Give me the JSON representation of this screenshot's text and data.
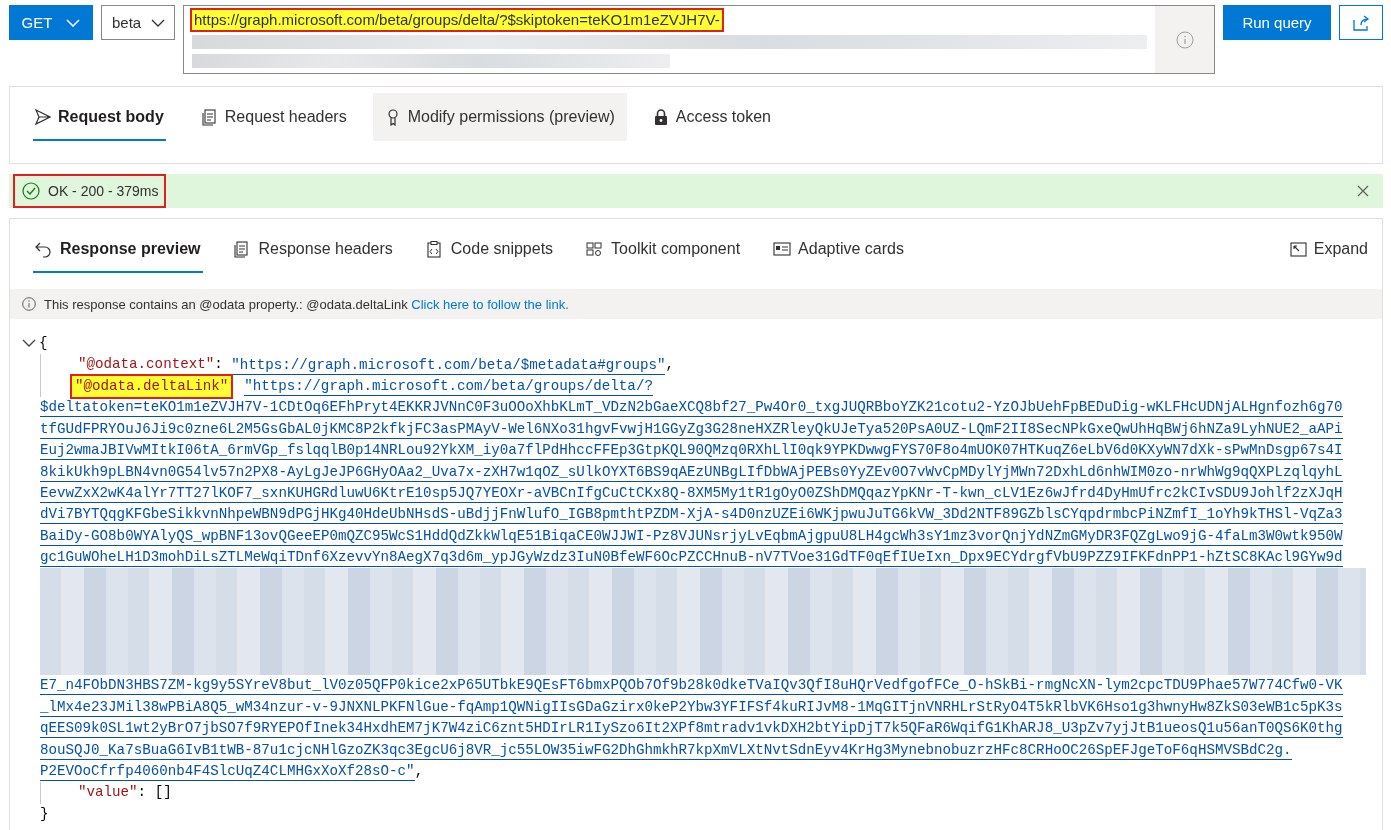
{
  "query_bar": {
    "method": "GET",
    "version": "beta",
    "url": "https://graph.microsoft.com/beta/groups/delta/?$skiptoken=teKO1m1eZVJH7V-",
    "url_highlighted": true,
    "run_button": "Run query"
  },
  "request_tabs": [
    {
      "label": "Request body",
      "selected": true,
      "hovered": false
    },
    {
      "label": "Request headers",
      "selected": false,
      "hovered": false
    },
    {
      "label": "Modify permissions (preview)",
      "selected": false,
      "hovered": true
    },
    {
      "label": "Access token",
      "selected": false,
      "hovered": false
    }
  ],
  "status": {
    "text": "OK - 200 - 379ms",
    "highlighted": true
  },
  "response_tabs": [
    {
      "label": "Response preview",
      "selected": true
    },
    {
      "label": "Response headers",
      "selected": false
    },
    {
      "label": "Code snippets",
      "selected": false
    },
    {
      "label": "Toolkit component",
      "selected": false
    },
    {
      "label": "Adaptive cards",
      "selected": false
    }
  ],
  "expand_button": "Expand",
  "notice": {
    "text": "This response contains an @odata property.: @odata.deltaLink ",
    "link": "Click here to follow the link."
  },
  "response_json": {
    "expanded": true,
    "open_brace": "{",
    "close_brace": "}",
    "properties": [
      {
        "key": "\"@odata.context\"",
        "separator": ":",
        "highlighted": false,
        "kind": "link",
        "first_line": "\"https://graph.microsoft.com/beta/$metadata#groups\"",
        "trailing": ","
      },
      {
        "key": "\"@odata.deltaLink\"",
        "highlighted": true,
        "kind": "link",
        "first_line": "\"https://graph.microsoft.com/beta/groups/delta/?",
        "lines": [
          {
            "kind": "text",
            "text": "$deltatoken=teKO1m1eZVJH7V-1CDtOq6EFhPryt4EKKRJVNnC0F3uOOoXhbKLmT_VDzN2bGaeXCQ8bf27_Pw4Or0_txgJUQRBboYZK21cotu2-YzOJbUehFpBEDuDig-wKLFHcUDNjALHgnfozh6g70"
          },
          {
            "kind": "text",
            "text": "tfGUdFPRYOuJ6Ji9c0zne6L2M5GsGbAL0jKMC8P2kfkjFC3asPMAyV-Wel6NXo31hgvFvwjH1GGyZg3G28neHXZRleyQkUJeTya520PsA0UZ-LQmF2II8SecNPkGxeQwUhHqBWj6hNZa9LyhNUE2_aAPi"
          },
          {
            "kind": "text",
            "text": "Euj2wmaJBIVwMItkI06tA_6rmVGp_fslqqlB0p14NRLou92YkXM_iy0a7flPdHhccFFEp3GtpKQL90QMzq0RXhLlI0qk9YPKDwwgFYS70F8o4mUOK07HTKuqZ6eLbV6d0KXyWN7dXk-sPwMnDsgp67s4I"
          },
          {
            "kind": "text",
            "text": "8kikUkh9pLBN4vn0G54lv57n2PX8-AyLgJeJP6GHyOAa2_Uva7x-zXH7w1qOZ_sUlkOYXT6BS9qAEzUNBgLIfDbWAjPEBs0YyZEv0O7vWvCpMDylYjMWn72DxhLd6nhWIM0zo-nrWhWg9qQXPLzqlqyhL"
          },
          {
            "kind": "text",
            "text": "EevwZxX2wK4alYr7TT27lKOF7_sxnKUHGRdluwU6KtrE10sp5JQ7YEOXr-aVBCnIfgCuCtCKx8Q-8XM5My1tR1gOyO0ZShDMQqazYpKNr-T-kwn_cLV1Ez6wJfrd4DyHmUfrc2kCIvSDU9Johlf2zXJqH"
          },
          {
            "kind": "text",
            "text": "dVi7BYTQqgKFGbeSikkvnNhpeWBN9dPGjHKg40HdeUbNHsdS-uBdjjFnWlufO_IGB8pmthtPZDM-XjA-s4D0nzUZEi6WKjpwuJuTG6kVW_3Dd2NTF89GZblsCYqpdrmbcPiNZmfI_1oYh9kTHSl-VqZa3"
          },
          {
            "kind": "text",
            "text": "BaiDy-GO8b0WYAlyQS_wpBNF13ovQGeeEP0mQZC95WcS1HddQdZkkWlqE51BiqaCE0WJJWI-Pz8VJUNsrjyLvEqbmAjgpuU8LH4gcWh3sY1mz3vorQnjYdNZmGMyDR3FQZgLwo9jG-4faLm3W0wtk950W"
          },
          {
            "kind": "text",
            "text": "gc1GuWOheLH1D3mohDiLsZTLMeWqiTDnf6XzevvYn8AegX7q3d6m_ypJGyWzdz3IuN0BfeWF6OcPZCCHnuB-nV7TVoe31GdTF0qEfIUeIxn_Dpx9ECYdrgfVbU9PZZ9IFKFdnPP1-hZtSC8KAcl9GYw9d"
          },
          {
            "kind": "redacted"
          },
          {
            "kind": "text",
            "text": "E7_n4FObDN3HBS7ZM-kg9y5SYreV8but_lV0z05QFP0kice2xP65UTbkE9QEsFT6bmxPQOb7Of9b28k0dkeTVaIQv3QfI8uHQrVedfgofFCe_O-hSkBi-rmgNcXN-lym2cpcTDU9Phae57W774Cfw0-VK"
          },
          {
            "kind": "text",
            "text": "_lMx4e23JMil38wPBiA8Q5_wM34nzur-v-9JNXNLPKFNlGue-fqAmp1QWNigIIsGDaGzirx0keP2Ybw3YFIFSf4kuRIJvM8-1MqGITjnVNRHLrStRyO4T5kRlbVK6Hso1g3hwnyHw8ZkS03eWB1c5pK3s"
          },
          {
            "kind": "text",
            "text": "qEES09k0SL1wt2yBrO7jbSO7f9RYEPOfInek34HxdhEM7jK7W4ziC6znt5HDIrLR1IySzo6It2XPf8mtradv1vkDXH2btYipDjT7k5QFaR6WqifG1KhARJ8_U3pZv7yjJtB1ueosQ1u56anT0QS6K0thg"
          },
          {
            "kind": "text",
            "text": "8ouSQJ0_Ka7sBuaG6IvB1tWB-87u1cjcNHlGzoZK3qc3EgcU6j8VR_jc55LOW35iwFG2DhGhmkhR7kpXmVLXtNvtSdnEyv4KrHg3MynebnobuzrzHFc8CRHoOC26SpEFJgeToF6qHSMVSBdC2g."
          },
          {
            "kind": "text",
            "text": "P2EVOoCfrfp4060nb4F4SlcUqZ4CLMHGxXoXf28sO-c\""
          }
        ],
        "trailing": ","
      },
      {
        "key": "\"value\"",
        "separator": ":",
        "highlighted": false,
        "kind": "array",
        "first_line": "[]"
      }
    ]
  }
}
